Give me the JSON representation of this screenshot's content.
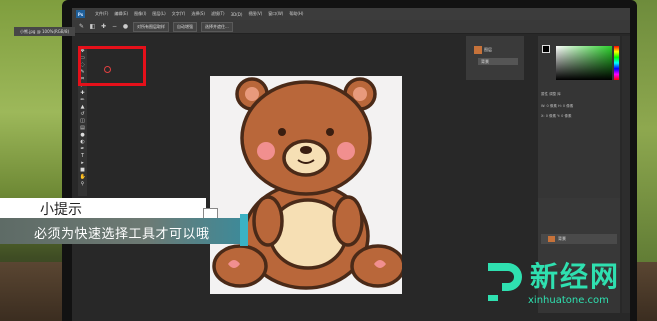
{
  "menubar": {
    "logo": "Ps",
    "items": [
      "文件(F)",
      "编辑(E)",
      "图像(I)",
      "图层(L)",
      "文字(Y)",
      "选择(S)",
      "滤镜(T)",
      "3D(D)",
      "视图(V)",
      "窗口(W)",
      "帮助(H)"
    ]
  },
  "options": {
    "buttons": [
      "对所有图层取样",
      "自动增强",
      "选择并遮住..."
    ]
  },
  "document": {
    "tab_label": "小熊.jpg @ 100%(RGB/8)"
  },
  "layers_mini": {
    "layer_label": "图层",
    "row_label": "背景"
  },
  "props": {
    "lines": [
      "属性  调整  库",
      "W: 0 像素   H: 0 像素",
      "X: 0 像素   Y: 0 像素"
    ]
  },
  "layers_panel": {
    "layer_label": "背景"
  },
  "caption": {
    "title": "小提示",
    "body": "必须为快速选择工具才可以哦"
  },
  "watermark": {
    "brand": "新经网",
    "url": "xinhuatone.com"
  },
  "colors": {
    "highlight": "#e5101a",
    "ps_bg": "#282828",
    "watermark": "#2fe0b0"
  }
}
